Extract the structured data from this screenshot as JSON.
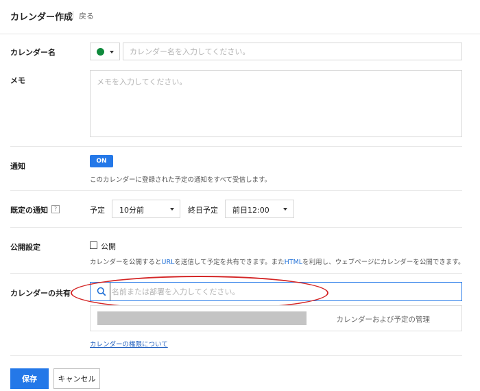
{
  "header": {
    "title": "カレンダー作成",
    "back_label": "戻る"
  },
  "calendar_name": {
    "label": "カレンダー名",
    "color": "#0f8a3c",
    "placeholder": "カレンダー名を入力してください。"
  },
  "memo": {
    "label": "メモ",
    "placeholder": "メモを入力してください。"
  },
  "notification": {
    "label": "通知",
    "toggle": "ON",
    "helper": "このカレンダーに登録された予定の通知をすべて受信します。"
  },
  "default_notification": {
    "label": "既定の通知",
    "help_icon": "?",
    "event_label": "予定",
    "event_value": "10分前",
    "allday_label": "終日予定",
    "allday_value": "前日12:00"
  },
  "publish": {
    "label": "公開設定",
    "checkbox_label": "公開",
    "checked": false,
    "helper_pre": "カレンダーを公開すると",
    "helper_url": "URL",
    "helper_mid": "を送信して予定を共有できます。また",
    "helper_html": "HTML",
    "helper_post": "を利用し、ウェブページにカレンダーを公開できます。"
  },
  "share": {
    "label": "カレンダーの共有",
    "placeholder": "名前または部署を入力してください。",
    "permission_label": "カレンダーおよび予定の管理",
    "permissions_link": "カレンダーの権限について"
  },
  "actions": {
    "save": "保存",
    "cancel": "キャンセル"
  },
  "colors": {
    "accent": "#2478e8",
    "annotation": "#d42626"
  }
}
